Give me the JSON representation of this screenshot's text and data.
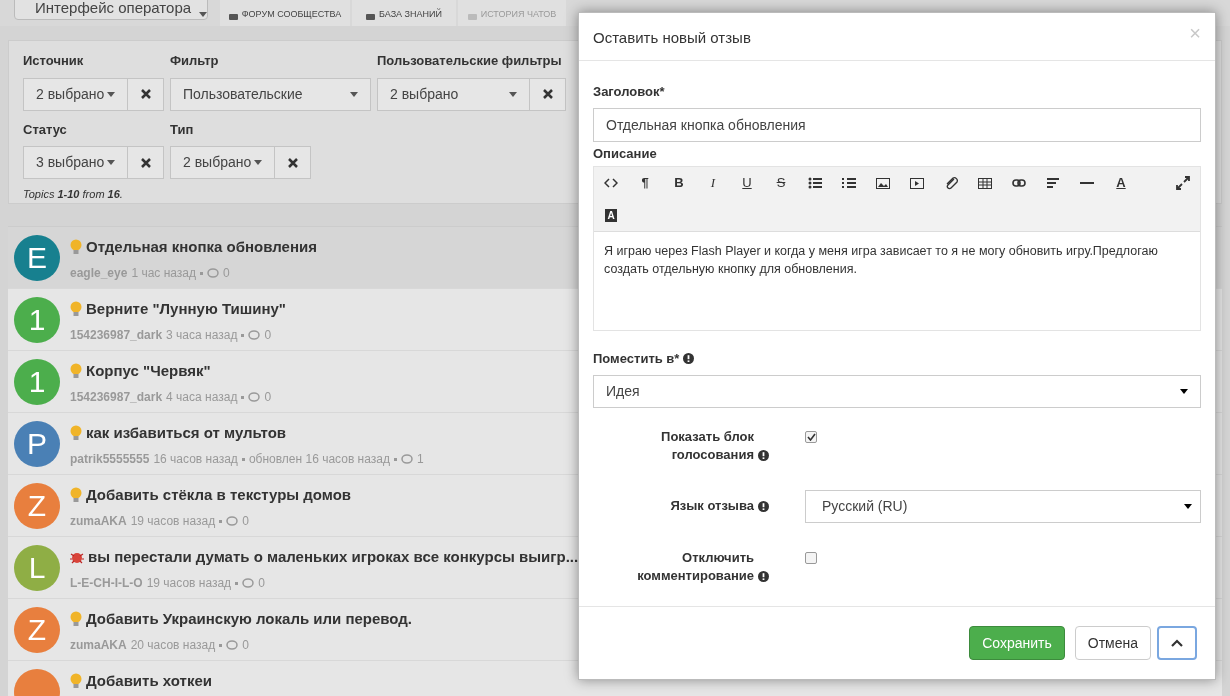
{
  "header": {
    "operator_button": "Интерфейс оператора",
    "stats": [
      {
        "label": "ФОРУМ СООБЩЕСТВА",
        "disabled": false
      },
      {
        "label": "БАЗА ЗНАНИЙ",
        "disabled": false
      },
      {
        "label": "ИСТОРИЯ ЧАТОВ",
        "disabled": true
      }
    ]
  },
  "filter_rows": [
    [
      {
        "label": "Источник",
        "value": "2 выбрано",
        "wide": false,
        "clearable": true
      },
      {
        "label": "Фильтр",
        "value": "Пользовательские",
        "wide": true,
        "clearable": false
      },
      {
        "label": "Пользовательские фильтры",
        "value": "2 выбрано",
        "wide": false,
        "clearable": true
      }
    ],
    [
      {
        "label": "Статус",
        "value": "3 выбрано",
        "wide": false,
        "clearable": true
      },
      {
        "label": "Тип",
        "value": "2 выбрано",
        "wide": false,
        "clearable": true
      }
    ]
  ],
  "topics_summary": "Topics **1-10** from **16**.",
  "topics": [
    {
      "letter": "E",
      "color": "#17808f",
      "kind": "idea",
      "title": "Отдельная кнопка обновления",
      "author": "eagle_eye",
      "meta": [
        "1 час назад"
      ],
      "comments": "0",
      "selected": true
    },
    {
      "letter": "1",
      "color": "#4cae4c",
      "kind": "idea",
      "title": "Верните \"Лунную Тишину\"",
      "author": "154236987_dark",
      "meta": [
        "3 часа назад"
      ],
      "comments": "0",
      "selected": false
    },
    {
      "letter": "1",
      "color": "#4cae4c",
      "kind": "idea",
      "title": "Корпус \"Червяк\"",
      "author": "154236987_dark",
      "meta": [
        "4 часа назад"
      ],
      "comments": "0",
      "selected": false
    },
    {
      "letter": "P",
      "color": "#4a80b5",
      "kind": "idea",
      "title": "как избавиться от мультов",
      "author": "patrik5555555",
      "meta": [
        "16 часов назад",
        "обновлен 16 часов назад"
      ],
      "comments": "1",
      "selected": false
    },
    {
      "letter": "Z",
      "color": "#e87f3e",
      "kind": "idea",
      "title": "Добавить стёкла в текстуры домов",
      "author": "zumaAKA",
      "meta": [
        "19 часов назад"
      ],
      "comments": "0",
      "selected": false
    },
    {
      "letter": "L",
      "color": "#8fae45",
      "kind": "bug",
      "title": "вы перестали думать о маленьких игроках все конкурсы выигр...",
      "author": "L-E-CH-I-L-O",
      "meta": [
        "19 часов назад"
      ],
      "comments": "0",
      "selected": false
    },
    {
      "letter": "Z",
      "color": "#e87f3e",
      "kind": "idea",
      "title": "Добавить Украинскую локаль или перевод.",
      "author": "zumaAKA",
      "meta": [
        "20 часов назад"
      ],
      "comments": "0",
      "selected": false
    },
    {
      "color": "#e87f3e",
      "kind": "idea",
      "title": "Добавить хоткеи",
      "selected": false
    }
  ],
  "modal": {
    "title": "Оставить новый отзыв",
    "close": "×",
    "title_field": {
      "label": "Заголовок*",
      "value": "Отдельная кнопка обновления"
    },
    "description": {
      "label": "Описание",
      "tools": [
        {
          "kind": "code"
        },
        {
          "kind": "paragraph",
          "text": "¶"
        },
        {
          "kind": "bold",
          "text": "B"
        },
        {
          "kind": "italic",
          "text": "I"
        },
        {
          "kind": "underline",
          "text": "U"
        },
        {
          "kind": "strike",
          "text": "S"
        },
        {
          "kind": "bullets"
        },
        {
          "kind": "numbers"
        },
        {
          "kind": "image"
        },
        {
          "kind": "video"
        },
        {
          "kind": "attach"
        },
        {
          "kind": "table"
        },
        {
          "kind": "link"
        },
        {
          "kind": "align"
        },
        {
          "kind": "rule"
        },
        {
          "kind": "color",
          "text": "A"
        },
        {
          "kind": "fullscreen"
        },
        {
          "kind": "background",
          "text": "A"
        }
      ],
      "text": "Я играю через Flash Player и когда у меня игра зависает то я не могу обновить игру.Предлогаю создать отдельную кнопку для обновления."
    },
    "place": {
      "label": "Поместить в*",
      "value": "Идея"
    },
    "options": [
      {
        "kind": "checkbox",
        "label": "Показать блок голосования",
        "checked": true
      },
      {
        "kind": "select",
        "label": "Язык отзыва",
        "value": "Русский (RU)"
      },
      {
        "kind": "checkbox",
        "label": "Отключить комментирование",
        "checked": false
      }
    ],
    "buttons": [
      {
        "kind": "primary",
        "label": "Сохранить"
      },
      {
        "kind": "default",
        "label": "Отмена"
      },
      {
        "kind": "up"
      }
    ]
  }
}
